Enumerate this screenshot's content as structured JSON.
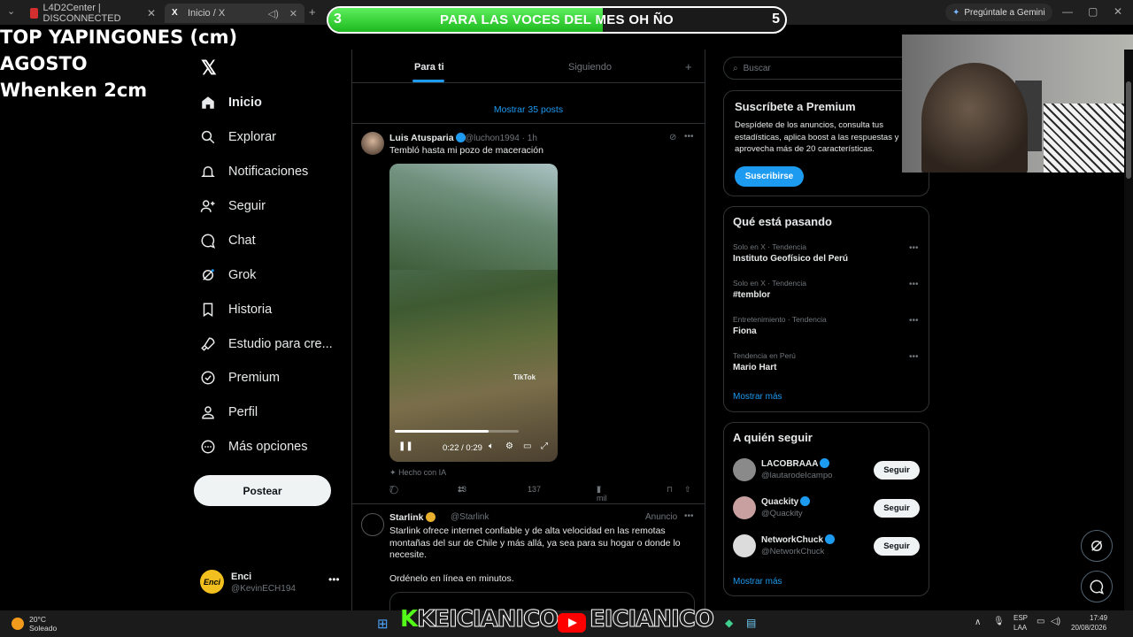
{
  "browser": {
    "tabs": [
      {
        "label": "L4D2Center | DISCONNECTED",
        "icon": "l4d2-favicon-icon",
        "color": "#d32f2f"
      },
      {
        "label": "Inicio / X",
        "icon": "x-favicon-icon",
        "color": "#000000"
      }
    ],
    "gemini_label": "Pregúntale a Gemini"
  },
  "overlay": {
    "banner_left_num": "3",
    "banner_text": "PARA LAS VOCES DEL MES OH ÑO",
    "banner_right_num": "5",
    "banner_progress": 0.6,
    "line1": "TOP YAPINGONES (cm)",
    "line2": "AGOSTO",
    "line3": "Whenken 2cm"
  },
  "nav": {
    "items": [
      {
        "label": "Inicio",
        "icon": "home-icon"
      },
      {
        "label": "Explorar",
        "icon": "search-icon"
      },
      {
        "label": "Notificaciones",
        "icon": "bell-icon"
      },
      {
        "label": "Seguir",
        "icon": "follow-icon"
      },
      {
        "label": "Chat",
        "icon": "chat-icon"
      },
      {
        "label": "Grok",
        "icon": "grok-icon"
      },
      {
        "label": "Historia",
        "icon": "bookmark-icon"
      },
      {
        "label": "Estudio para cre...",
        "icon": "rocket-icon"
      },
      {
        "label": "Premium",
        "icon": "premium-icon"
      },
      {
        "label": "Perfil",
        "icon": "person-icon"
      },
      {
        "label": "Más opciones",
        "icon": "more-icon"
      }
    ],
    "post_label": "Postear"
  },
  "account": {
    "name": "Enci",
    "handle": "@KevinECH194",
    "avatar_text": "Enci"
  },
  "timeline": {
    "tab_for_you": "Para ti",
    "tab_following": "Siguiendo",
    "show_posts": "Mostrar 35 posts",
    "tweet1": {
      "name": "Luis Atusparia",
      "handle": "@luchon1994",
      "time": "· 1h",
      "text": "Tembló hasta mi pozo de maceración",
      "video_time": "0:22 / 0:29",
      "video_progress": 0.76,
      "watermark": "TikTok",
      "ai_label": "Hecho con IA",
      "replies": "7",
      "reposts": "13",
      "likes": "137",
      "views": "7 mil"
    },
    "tweet2": {
      "name": "Starlink",
      "handle": "@Starlink",
      "ad_label": "Anuncio",
      "text": "Starlink ofrece internet confiable y de alta velocidad en las remotas montañas del sur de Chile y más allá, ya sea para su hogar o donde lo necesite.",
      "text2": "Ordénelo en línea en minutos."
    }
  },
  "right": {
    "search_placeholder": "Buscar",
    "premium_title": "Suscríbete a Premium",
    "premium_text": "Despídete de los anuncios, consulta tus estadísticas, aplica boost a las respuestas y aprovecha más de 20 características.",
    "subscribe_label": "Suscribirse",
    "trends_title": "Qué está pasando",
    "trends": [
      {
        "context": "Solo en X · Tendencia",
        "name": "Instituto Geofísico del Perú"
      },
      {
        "context": "Solo en X · Tendencia",
        "name": "#temblor"
      },
      {
        "context": "Entretenimiento · Tendencia",
        "name": "Fiona"
      },
      {
        "context": "Tendencia en Perú",
        "name": "Mario Hart"
      }
    ],
    "show_more": "Mostrar más",
    "wtf_title": "A quién seguir",
    "wtf": [
      {
        "name": "LACOBRAAA",
        "handle": "@lautarodeIcampo",
        "color": "#8a8a8a"
      },
      {
        "name": "Quackity",
        "handle": "@Quackity",
        "color": "#c9a0a0"
      },
      {
        "name": "NetworkChuck",
        "handle": "@NetworkChuck",
        "color": "#dcdcdc"
      }
    ],
    "follow_label": "Seguir"
  },
  "taskbar": {
    "temp": "20°C",
    "weather": "Soleado",
    "brand1": "KEICIANICO",
    "brand2": "EICIANICO",
    "lang1": "ESP",
    "lang2": "LAA",
    "time": "17:49",
    "date": "20/08/2026"
  }
}
